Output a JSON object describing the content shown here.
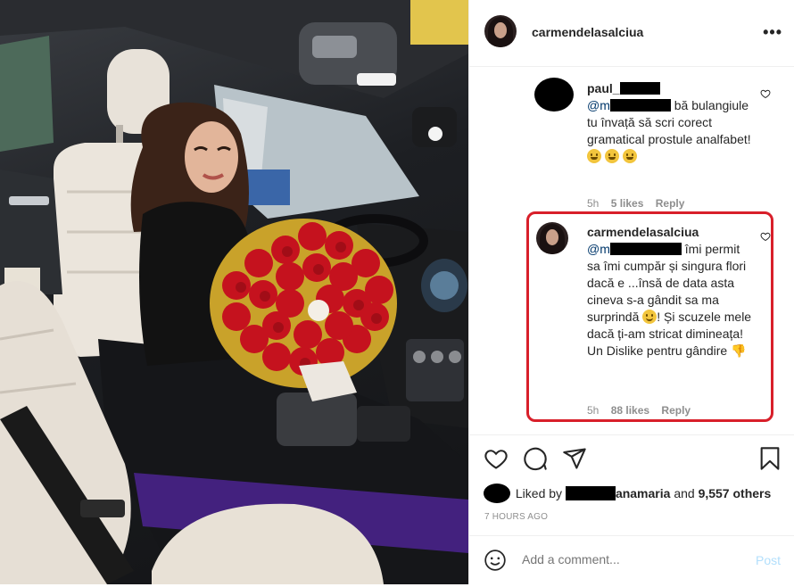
{
  "header": {
    "username": "carmendelasalciua",
    "more_icon": "more-options-icon"
  },
  "comments": [
    {
      "username": "paul_",
      "mention": "@m",
      "text": "bă bulangiule tu învață să scri corect gramatical prostule analfabet!",
      "emojis": [
        "grinning-sweat",
        "grinning-sweat",
        "grinning-sweat"
      ],
      "time": "5h",
      "likes": "5 likes",
      "reply": "Reply"
    },
    {
      "username": "carmendelasalciua",
      "mention": "@m",
      "text_1": "îmi permit sa îmi cumpăr și singura flori dacă e ...însă de data asta cineva s-a gândit sa ma surprindă",
      "text_2": "! Și scuzele mele dacă ți-am stricat dimineața! Un Dislike pentru gândire",
      "time": "5h",
      "likes": "88 likes",
      "reply": "Reply",
      "highlight_color": "#d81f2a"
    }
  ],
  "actions": {
    "liked_by_prefix": "Liked by",
    "liked_by_name": "anamaria",
    "liked_by_and": "and",
    "liked_by_others": "9,557 others",
    "time_ago": "7 HOURS AGO"
  },
  "add_comment": {
    "placeholder": "Add a comment...",
    "post_label": "Post"
  },
  "colors": {
    "link": "#00376b",
    "muted": "#8e8e8e",
    "post_disabled": "#b2dffc"
  }
}
